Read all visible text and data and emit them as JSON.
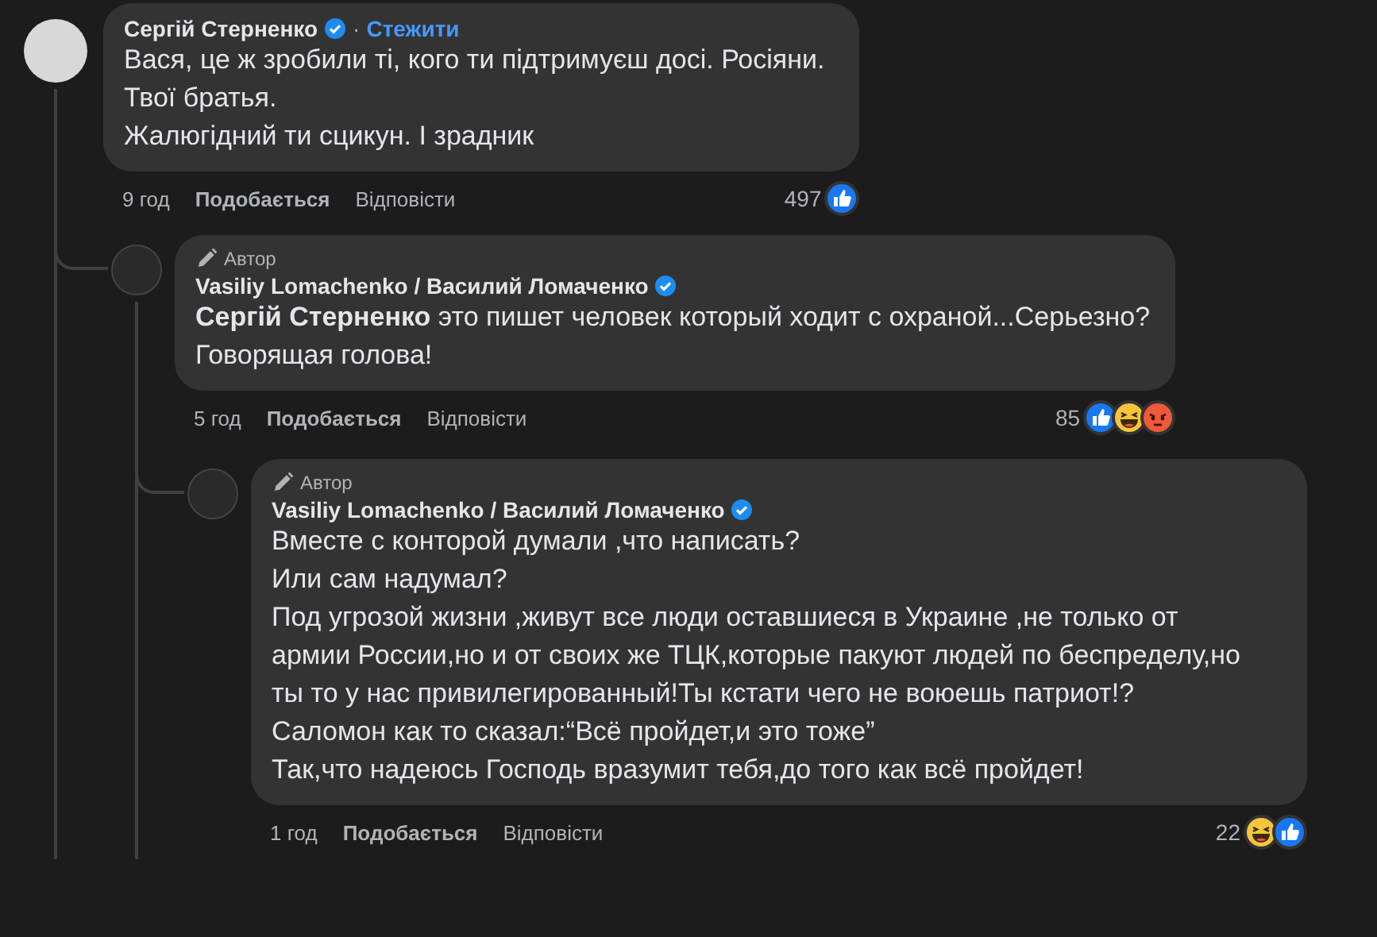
{
  "comments": [
    {
      "author": "Сергій Стерненко",
      "verified": true,
      "follow": {
        "separator": "·",
        "label": "Стежити"
      },
      "paragraphs": [
        "Вася, це ж зробили ті, кого ти підтримуєш досі. Росіяни.",
        "Твої братья.",
        "Жалюгідний ти сцикун. І зрадник"
      ],
      "time": "9 год",
      "like_label": "Подобається",
      "reply_label": "Відповісти",
      "reaction_count": "497",
      "reactions": [
        {
          "kind": "like"
        }
      ],
      "children": [
        {
          "author": "Vasiliy Lomachenko / Василий Ломаченко",
          "verified": true,
          "author_badge": "Автор",
          "paragraphs": [
            "**Сергій Стерненко** это пишет человек который ходит с охраной...Серьезно?",
            "Говорящая голова!"
          ],
          "time": "5 год",
          "like_label": "Подобається",
          "reply_label": "Відповісти",
          "reaction_count": "85",
          "reactions": [
            {
              "kind": "like"
            },
            {
              "kind": "haha"
            },
            {
              "kind": "angry"
            }
          ],
          "children": [
            {
              "author": "Vasiliy Lomachenko / Василий Ломаченко",
              "verified": true,
              "author_badge": "Автор",
              "paragraphs": [
                "Вместе с конторой думали ,что написать?",
                "Или сам надумал?",
                "Под угрозой жизни ,живут все люди оставшиеся в Украине ,не только от армии России,но и от своих же ТЦК,которые пакуют людей по беспределу,но ты то у нас привилегированный!Ты кстати чего не воюешь патриот!?",
                "Саломон как то сказал:“Всё пройдет,и это тоже”",
                "Так,что надеюсь Господь вразумит тебя,до того как всё пройдет!"
              ],
              "time": "1 год",
              "like_label": "Подобається",
              "reply_label": "Відповісти",
              "reaction_count": "22",
              "reactions": [
                {
                  "kind": "haha"
                },
                {
                  "kind": "like"
                }
              ]
            }
          ]
        }
      ]
    }
  ]
}
